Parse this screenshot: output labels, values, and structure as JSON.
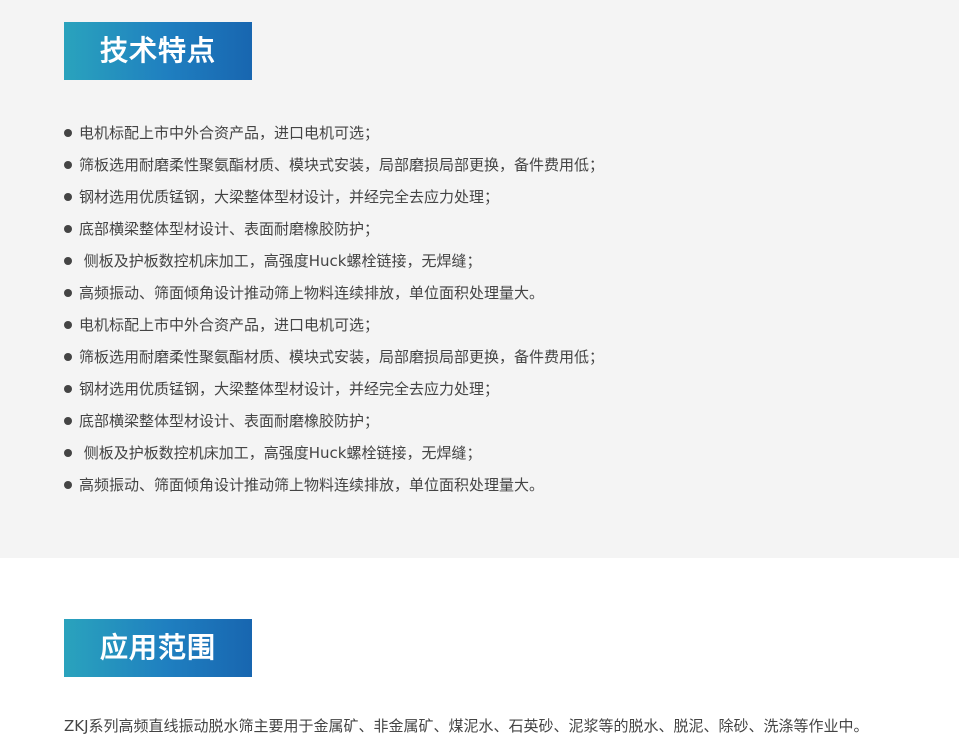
{
  "features": {
    "title": "技术特点",
    "items": [
      "电机标配上市中外合资产品，进口电机可选；",
      "筛板选用耐磨柔性聚氨酯材质、模块式安装，局部磨损局部更换，备件费用低；",
      "钢材选用优质锰钢，大梁整体型材设计，并经完全去应力处理；",
      "底部横梁整体型材设计、表面耐磨橡胶防护；",
      " 侧板及护板数控机床加工，高强度Huck螺栓链接，无焊缝；",
      "高频振动、筛面倾角设计推动筛上物料连续排放，单位面积处理量大。",
      "电机标配上市中外合资产品，进口电机可选；",
      "筛板选用耐磨柔性聚氨酯材质、模块式安装，局部磨损局部更换，备件费用低；",
      "钢材选用优质锰钢，大梁整体型材设计，并经完全去应力处理；",
      "底部横梁整体型材设计、表面耐磨橡胶防护；",
      " 侧板及护板数控机床加工，高强度Huck螺栓链接，无焊缝；",
      "高频振动、筛面倾角设计推动筛上物料连续排放，单位面积处理量大。"
    ]
  },
  "applications": {
    "title": "应用范围",
    "text": "ZKJ系列高频直线振动脱水筛主要用于金属矿、非金属矿、煤泥水、石英砂、泥浆等的脱水、脱泥、除砂、洗涤等作业中。"
  },
  "colors": {
    "banner_start": "#2aa3bd",
    "banner_end": "#1866b0",
    "section_background": "#f4f4f4",
    "text": "#444444"
  }
}
